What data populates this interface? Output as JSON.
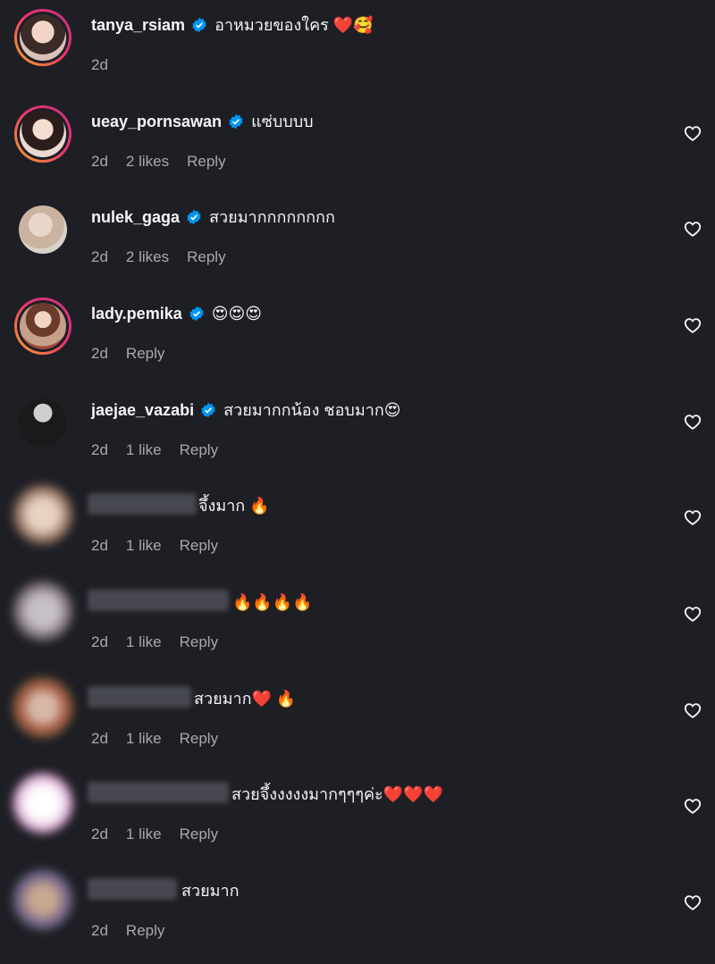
{
  "comments": [
    {
      "username": "tanya_rsiam",
      "verified": true,
      "text": "อาหมวยของใคร ❤️🥰",
      "time": "2d",
      "likes": "",
      "reply": "",
      "has_heart": false
    },
    {
      "username": "ueay_pornsawan",
      "verified": true,
      "text": "แซ่บบบบ",
      "time": "2d",
      "likes": "2 likes",
      "reply": "Reply",
      "has_heart": true
    },
    {
      "username": "nulek_gaga",
      "verified": true,
      "text": "สวยมากกกกกกกก",
      "time": "2d",
      "likes": "2 likes",
      "reply": "Reply",
      "has_heart": true
    },
    {
      "username": "lady.pemika",
      "verified": true,
      "text": "😍😍😍",
      "time": "2d",
      "likes": "",
      "reply": "Reply",
      "has_heart": true
    },
    {
      "username": "jaejae_vazabi",
      "verified": true,
      "text": "สวยมากกน้อง ชอบมาก😍",
      "time": "2d",
      "likes": "1 like",
      "reply": "Reply",
      "has_heart": true
    },
    {
      "username": "",
      "verified": false,
      "text": "จึ้งมาก 🔥",
      "time": "2d",
      "likes": "1 like",
      "reply": "Reply",
      "has_heart": true
    },
    {
      "username": "",
      "verified": false,
      "text": "🔥🔥🔥🔥",
      "time": "2d",
      "likes": "1 like",
      "reply": "Reply",
      "has_heart": true
    },
    {
      "username": "",
      "verified": false,
      "text": "สวยมาก❤️ 🔥",
      "time": "2d",
      "likes": "1 like",
      "reply": "Reply",
      "has_heart": true
    },
    {
      "username": "",
      "verified": false,
      "text": "สวยจึ้งงงงงมากๆๆๆค่ะ❤️❤️❤️",
      "time": "2d",
      "likes": "1 like",
      "reply": "Reply",
      "has_heart": true
    },
    {
      "username": "",
      "verified": false,
      "text": "สวยมาก",
      "time": "2d",
      "likes": "",
      "reply": "Reply",
      "has_heart": true
    }
  ],
  "colors": {
    "background": "#1e1f25",
    "verified": "#0095f6",
    "meta": "#a8a8ad",
    "story_ring": "#f0306f"
  },
  "icons": {
    "verified": "verified-badge-icon",
    "like": "heart-outline-icon"
  }
}
